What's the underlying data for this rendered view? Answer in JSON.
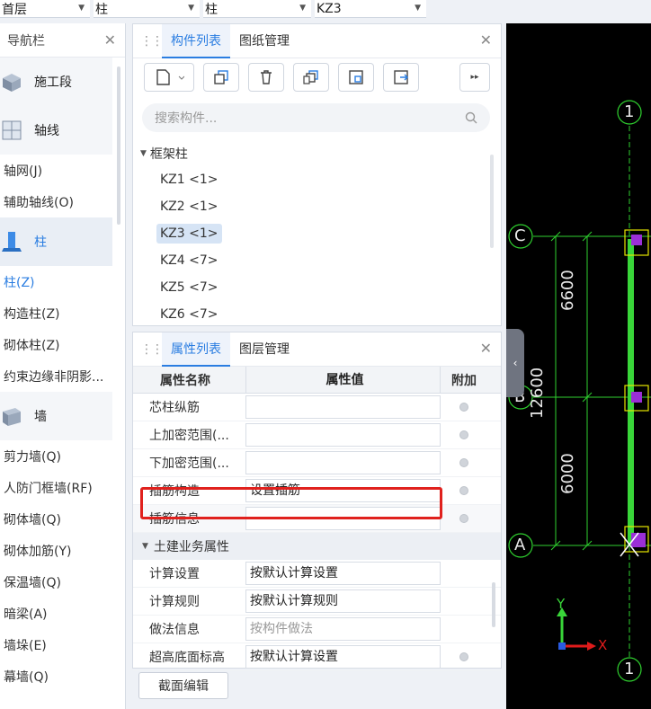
{
  "filters": [
    {
      "value": "首层"
    },
    {
      "value": "柱"
    },
    {
      "value": "柱"
    },
    {
      "value": "KZ3"
    }
  ],
  "nav": {
    "title": "导航栏",
    "groups": [
      {
        "label": "施工段",
        "icon": "construction-segment-icon"
      },
      {
        "label": "轴线",
        "icon": "grid-axis-icon"
      },
      {
        "label": "柱",
        "icon": "column-icon"
      },
      {
        "label": "墙",
        "icon": "wall-icon"
      }
    ],
    "axis_items": [
      "轴网(J)",
      "辅助轴线(O)"
    ],
    "column_items": [
      "柱(Z)",
      "构造柱(Z)",
      "砌体柱(Z)",
      "约束边缘非阴影..."
    ],
    "wall_items": [
      "剪力墙(Q)",
      "人防门框墙(RF)",
      "砌体墙(Q)",
      "砌体加筋(Y)",
      "保温墙(Q)",
      "暗梁(A)",
      "墙垛(E)",
      "幕墙(Q)"
    ]
  },
  "components_panel": {
    "tabs": [
      "构件列表",
      "图纸管理"
    ],
    "search_placeholder": "搜索构件...",
    "tree_parent": "框架柱",
    "items": [
      "KZ1 <1>",
      "KZ2 <1>",
      "KZ3 <1>",
      "KZ4 <7>",
      "KZ5 <7>",
      "KZ6 <7>"
    ],
    "selected": "KZ3 <1>"
  },
  "properties_panel": {
    "tabs": [
      "属性列表",
      "图层管理"
    ],
    "headers": {
      "name": "属性名称",
      "value": "属性值",
      "extra": "附加"
    },
    "rows": [
      {
        "name": "芯柱纵筋",
        "value": ""
      },
      {
        "name": "上加密范围(...",
        "value": ""
      },
      {
        "name": "下加密范围(...",
        "value": ""
      },
      {
        "name": "插筋构造",
        "value": "设置插筋"
      },
      {
        "name": "插筋信息",
        "value": ""
      }
    ],
    "section": "土建业务属性",
    "section_rows": [
      {
        "name": "计算设置",
        "value": "按默认计算设置"
      },
      {
        "name": "计算规则",
        "value": "按默认计算规则"
      },
      {
        "name": "做法信息",
        "value": "按构件做法"
      },
      {
        "name": "超高底面标高",
        "value": "按默认计算设置"
      }
    ],
    "bottom_button": "截面编辑"
  },
  "cad": {
    "axis_labels": {
      "one_top": "1",
      "c": "C",
      "b": "B",
      "a": "A",
      "one_bottom": "1"
    },
    "dims": {
      "upper": "6600",
      "total": "12600",
      "lower": "6000"
    },
    "ucs": {
      "y": "Y",
      "x": "X"
    },
    "colors": {
      "grid": "#2fd02f",
      "column": "#e6e600",
      "marker": "#9b2fd6"
    }
  }
}
